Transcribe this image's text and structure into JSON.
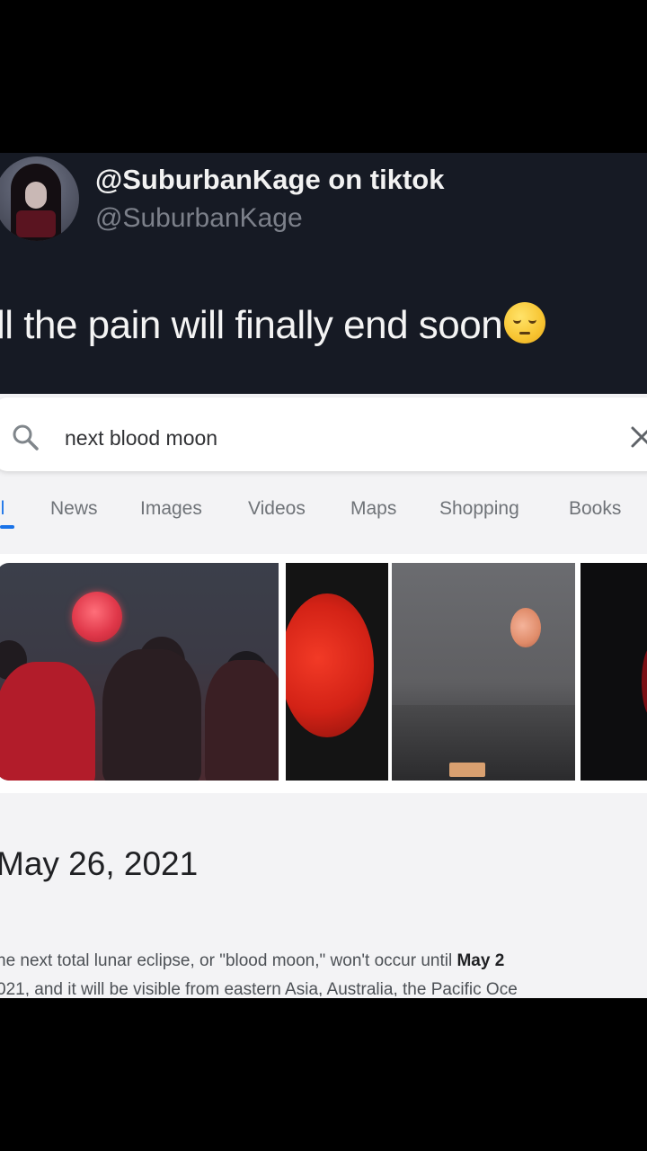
{
  "tweet": {
    "display_name": "@SuburbanKage on tiktok",
    "handle": "@SuburbanKage",
    "text": "ll the pain will finally end soon",
    "emoji_icon": "pensive-face-emoji"
  },
  "search": {
    "query": "next blood moon",
    "search_icon": "search-icon",
    "clear_icon": "close-icon"
  },
  "tabs": {
    "all": "ll",
    "news": "News",
    "images": "Images",
    "videos": "Videos",
    "maps": "Maps",
    "shopping": "Shopping",
    "books": "Books"
  },
  "result": {
    "date": "May 26, 2021",
    "snippet_line1_start": "he next total lunar eclipse, or \"blood moon,\" won't occur until ",
    "snippet_line1_bold": "May 2",
    "snippet_line2": "021, and it will be visible from eastern Asia, Australia, the Pacific Oce"
  },
  "colors": {
    "tweet_background": "#161a24",
    "accent": "#1a73e8",
    "blood_moon": "#d32216"
  }
}
